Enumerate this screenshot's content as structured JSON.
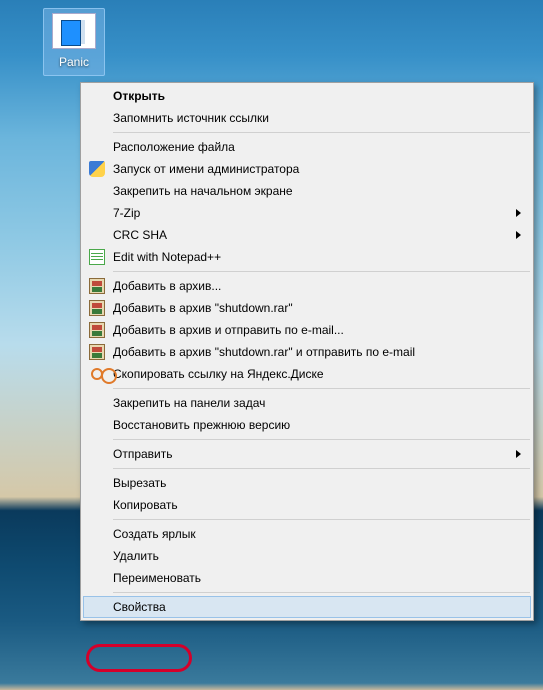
{
  "desktop": {
    "icon_label": "Panic"
  },
  "menu": {
    "open": "Открыть",
    "remember_link_source": "Запомнить источник ссылки",
    "file_location": "Расположение файла",
    "run_as_admin": "Запуск от имени администратора",
    "pin_start": "Закрепить на начальном экране",
    "seven_zip": "7-Zip",
    "crc_sha": "CRC SHA",
    "edit_notepad": "Edit with Notepad++",
    "add_archive": "Добавить в архив...",
    "add_archive_named": "Добавить в архив \"shutdown.rar\"",
    "add_archive_email": "Добавить в архив и отправить по e-mail...",
    "add_archive_named_email": "Добавить в архив \"shutdown.rar\" и отправить по e-mail",
    "copy_yadisk": "Скопировать ссылку на Яндекс.Диске",
    "pin_taskbar": "Закрепить на панели задач",
    "restore_previous": "Восстановить прежнюю версию",
    "send_to": "Отправить",
    "cut": "Вырезать",
    "copy": "Копировать",
    "create_shortcut": "Создать ярлык",
    "delete": "Удалить",
    "rename": "Переименовать",
    "properties": "Свойства"
  }
}
